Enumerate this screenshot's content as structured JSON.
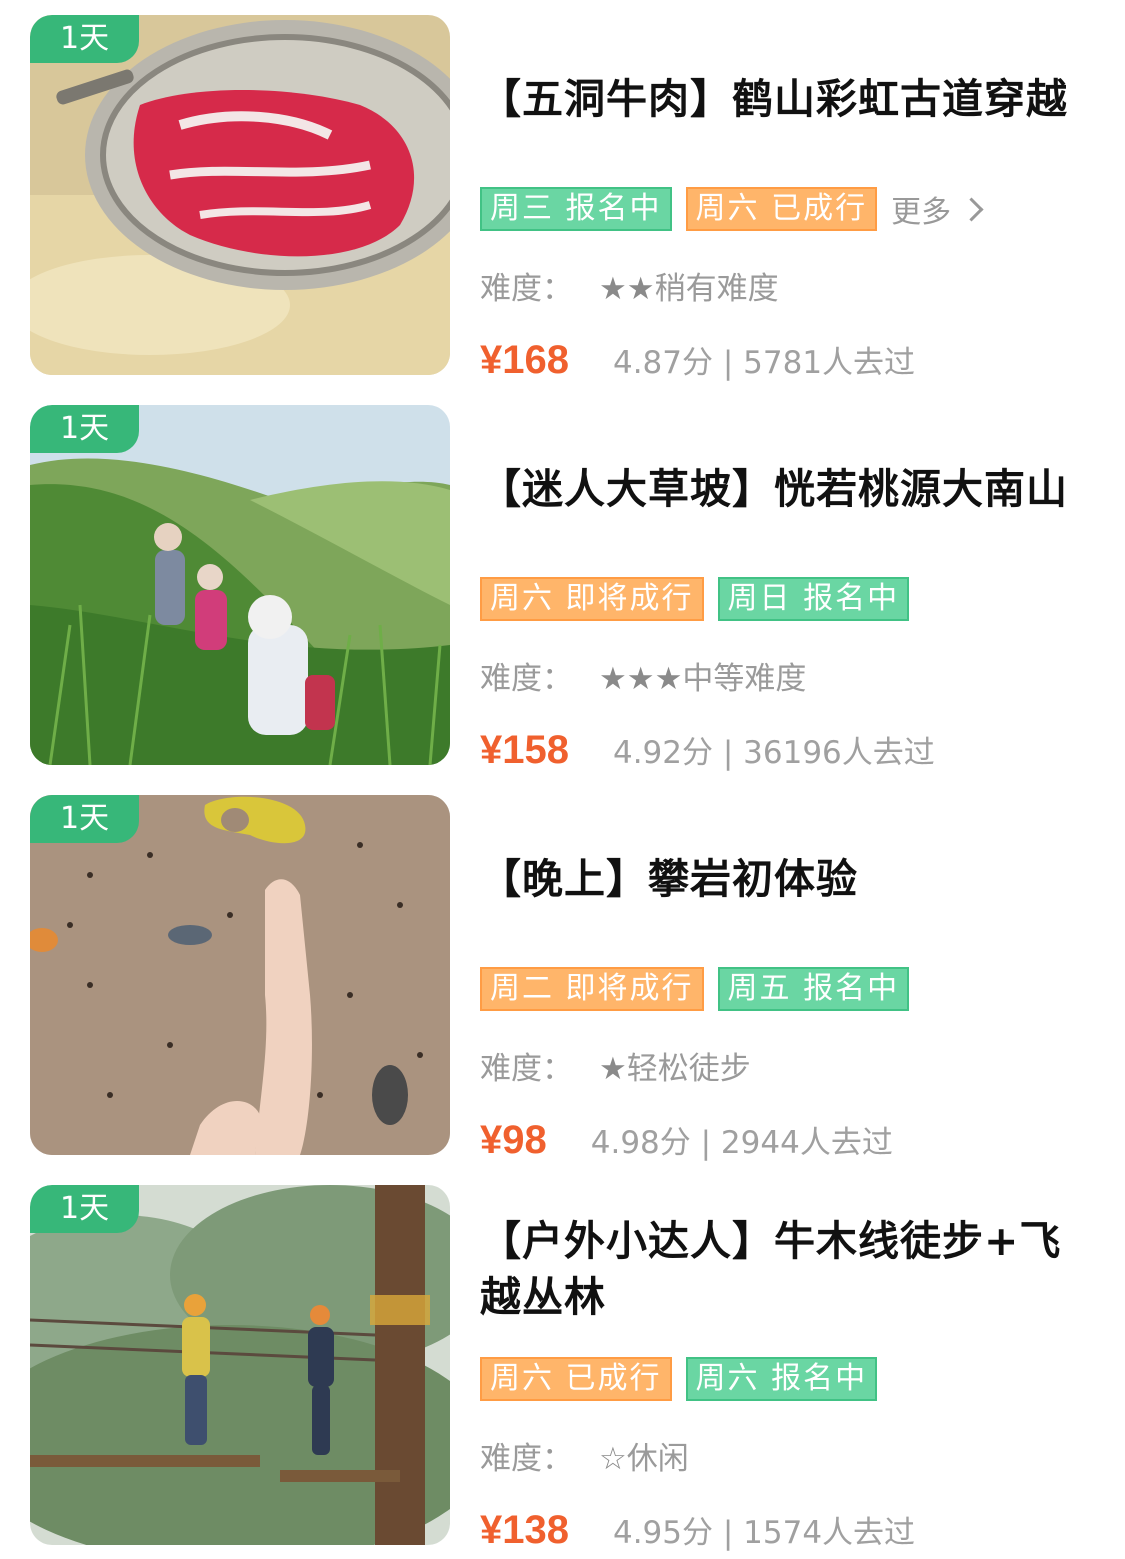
{
  "items": [
    {
      "days": "1天",
      "title": "【五洞牛肉】鹤山彩虹古道穿越",
      "tags": [
        {
          "text": "周三 报名中",
          "color": "green"
        },
        {
          "text": "周六 已成行",
          "color": "orange"
        }
      ],
      "more": "更多",
      "difficulty_label": "难度：",
      "stars": "★★",
      "difficulty_text": "稍有难度",
      "price": "¥168",
      "stats": "4.87分 | 5781人去过",
      "image": "beef-strainer-photo"
    },
    {
      "days": "1天",
      "title": "【迷人大草坡】恍若桃源大南山",
      "tags": [
        {
          "text": "周六 即将成行",
          "color": "orange"
        },
        {
          "text": "周日 报名中",
          "color": "green"
        }
      ],
      "difficulty_label": "难度：",
      "stars": "★★★",
      "difficulty_text": "中等难度",
      "price": "¥158",
      "stats": "4.92分 | 36196人去过",
      "image": "grass-slope-hikers-photo"
    },
    {
      "days": "1天",
      "title": "【晚上】攀岩初体验",
      "tags": [
        {
          "text": "周二 即将成行",
          "color": "orange"
        },
        {
          "text": "周五 报名中",
          "color": "green"
        }
      ],
      "difficulty_label": "难度：",
      "stars": "★",
      "difficulty_text": "轻松徒步",
      "price": "¥98",
      "stats": "4.98分 | 2944人去过",
      "image": "climbing-wall-photo"
    },
    {
      "days": "1天",
      "title": "【户外小达人】牛木线徒步+飞越丛林",
      "tags": [
        {
          "text": "周六 已成行",
          "color": "orange"
        },
        {
          "text": "周六 报名中",
          "color": "green"
        }
      ],
      "difficulty_label": "难度：",
      "stars": "☆",
      "difficulty_text": "休闲",
      "price": "¥138",
      "stats": "4.95分 | 1574人去过",
      "image": "forest-zipline-photo"
    }
  ],
  "colors": {
    "days_badge": "#37b779",
    "tag_green": "#6ad6a3",
    "tag_orange": "#ffb56a",
    "price": "#f0602e"
  }
}
